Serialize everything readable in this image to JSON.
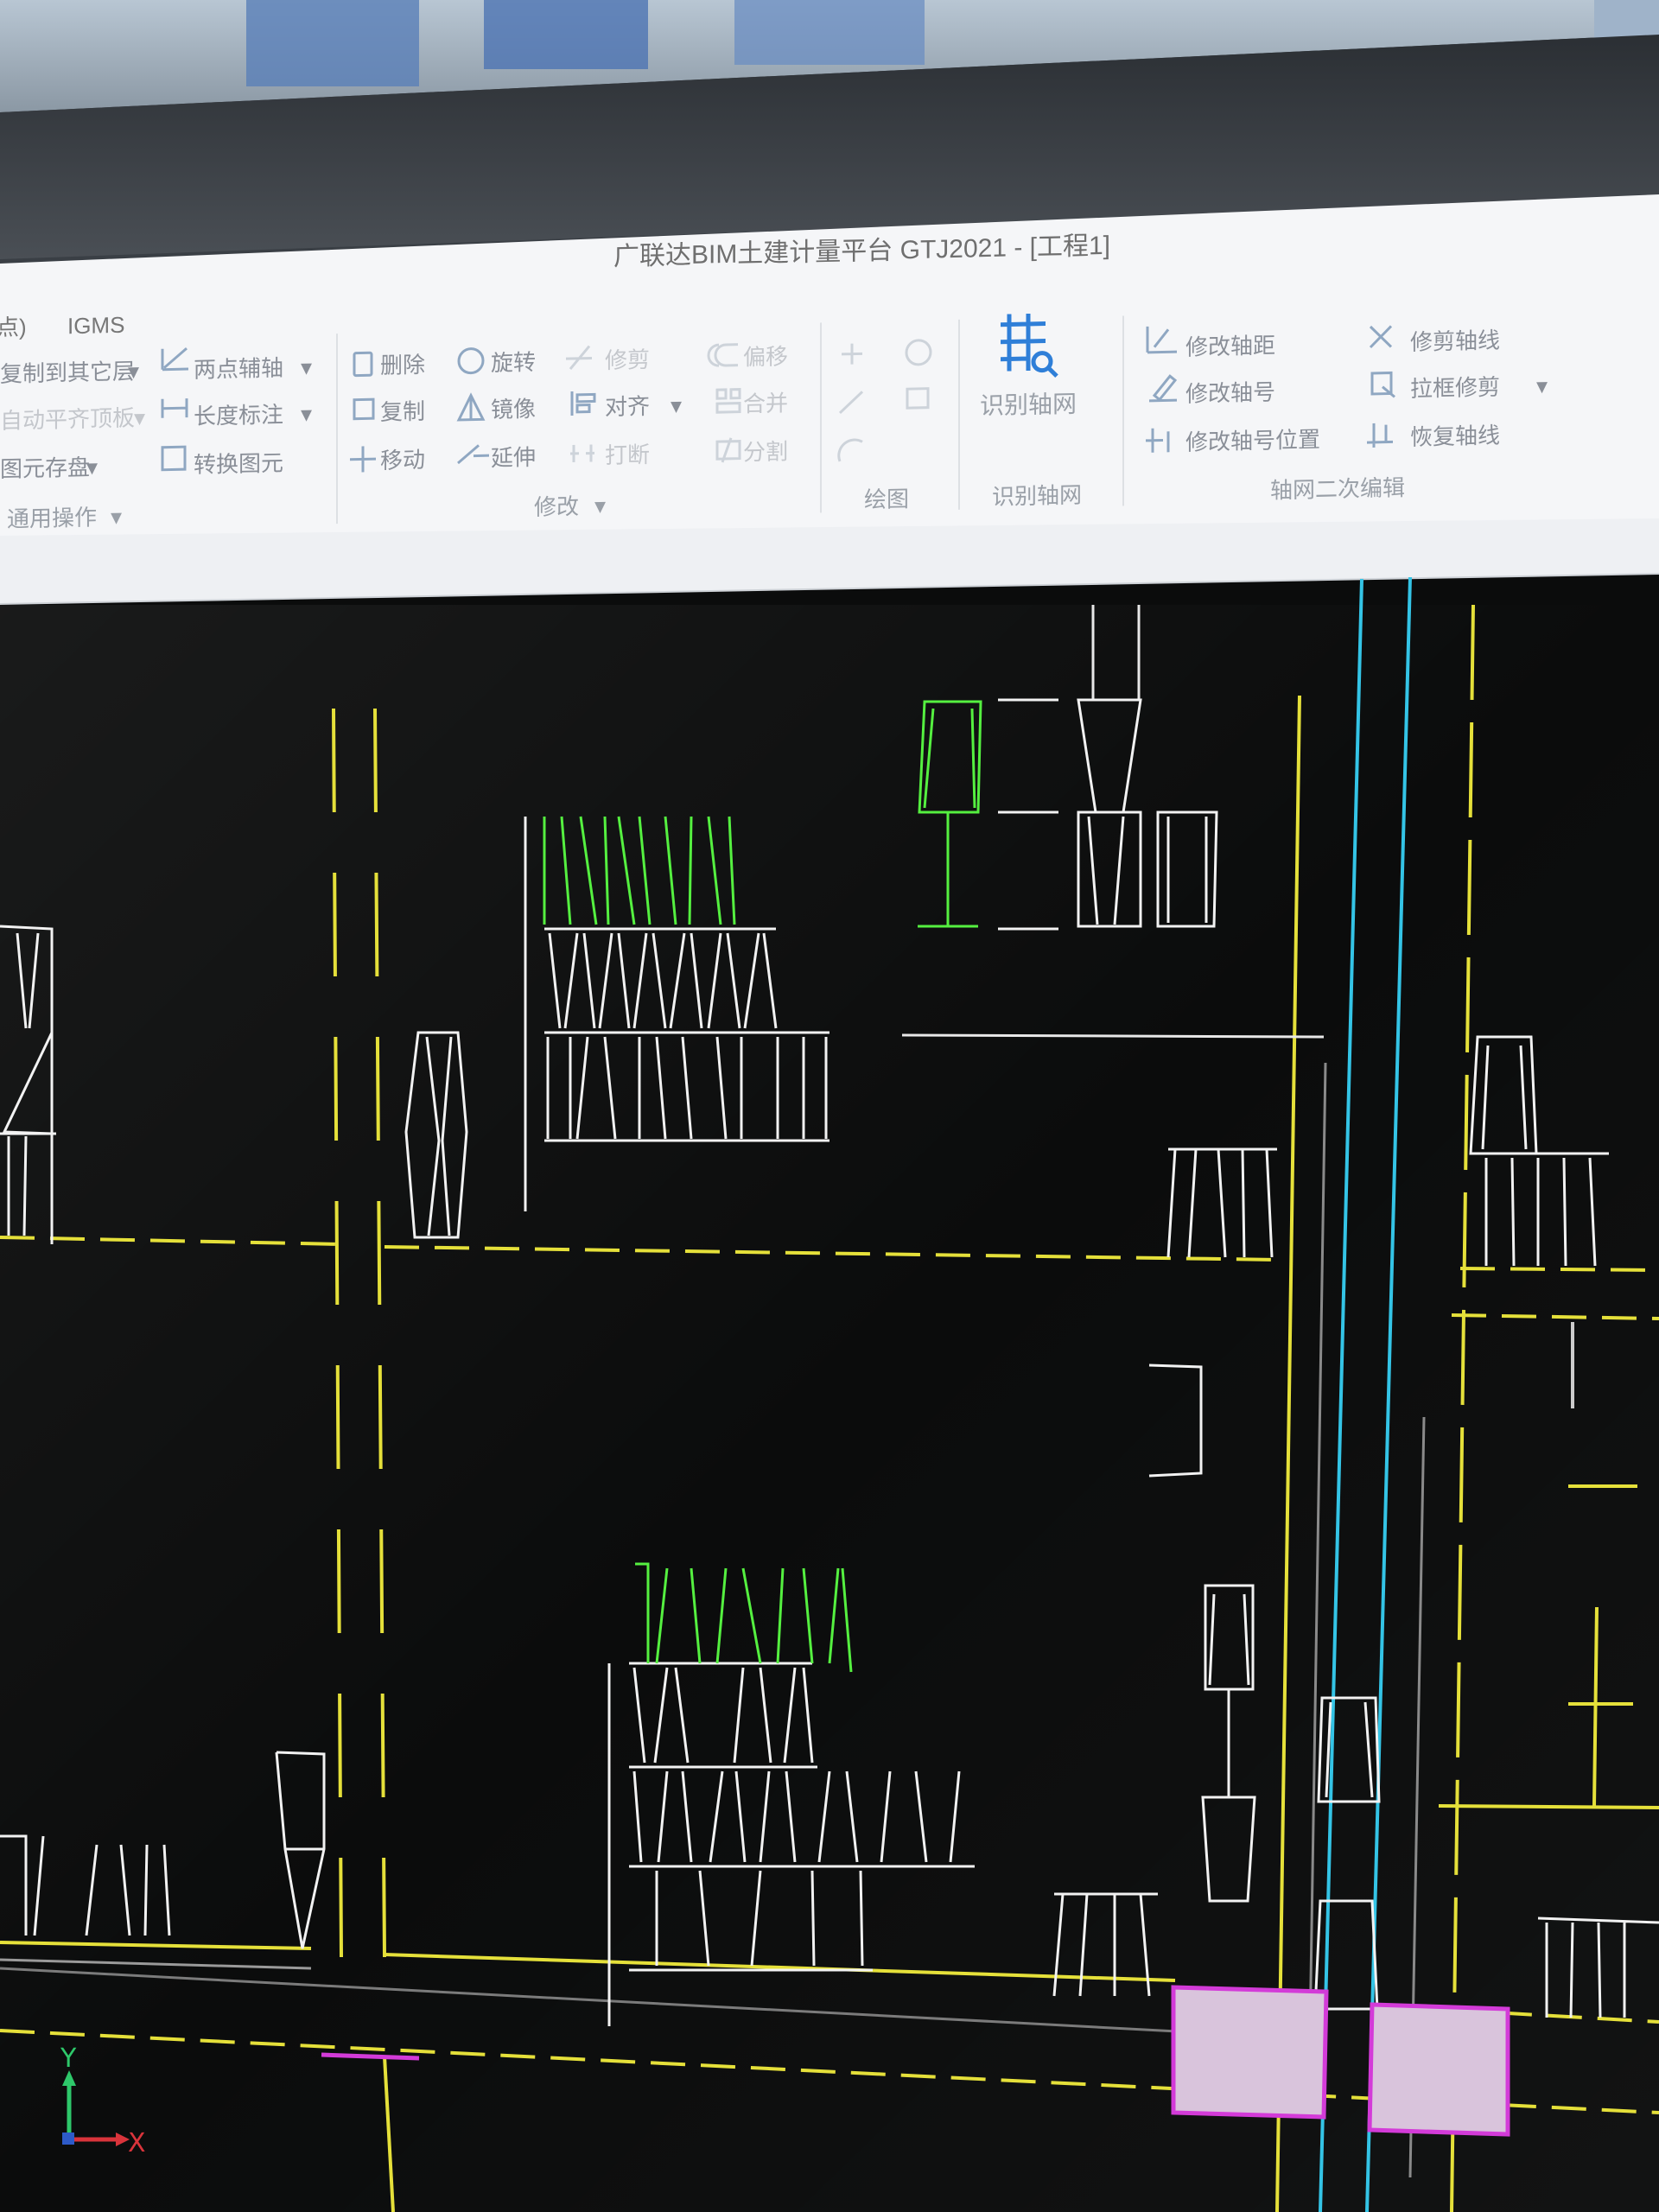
{
  "window": {
    "title": "广联达BIM土建计量平台 GTJ2021 - [工程1]"
  },
  "ribbon": {
    "tabs": [
      {
        "label": "点)"
      },
      {
        "label": "IGMS"
      }
    ],
    "general_group": {
      "items": [
        {
          "label": "复制到其它层",
          "dropdown": true
        },
        {
          "label": "自动平齐顶板",
          "dropdown": true,
          "disabled": true
        },
        {
          "label": "图元存盘",
          "dropdown": true
        },
        {
          "label": "通用操作",
          "dropdown": true
        }
      ],
      "aux_items": [
        {
          "label": "两点辅轴",
          "icon": "two-point-axis-icon",
          "dropdown": true
        },
        {
          "label": "长度标注",
          "icon": "length-dimension-icon",
          "dropdown": true
        },
        {
          "label": "转换图元",
          "icon": "convert-element-icon"
        }
      ]
    },
    "modify_group": {
      "title": "修改",
      "items": [
        {
          "label": "删除",
          "icon": "delete-icon"
        },
        {
          "label": "复制",
          "icon": "copy-icon"
        },
        {
          "label": "移动",
          "icon": "move-icon"
        },
        {
          "label": "旋转",
          "icon": "rotate-icon"
        },
        {
          "label": "镜像",
          "icon": "mirror-icon"
        },
        {
          "label": "延伸",
          "icon": "extend-icon"
        },
        {
          "label": "修剪",
          "icon": "trim-icon",
          "disabled": true
        },
        {
          "label": "对齐",
          "icon": "align-icon",
          "dropdown": true
        },
        {
          "label": "打断",
          "icon": "break-icon",
          "disabled": true
        },
        {
          "label": "偏移",
          "icon": "offset-icon",
          "disabled": true
        },
        {
          "label": "合并",
          "icon": "merge-icon",
          "disabled": true
        },
        {
          "label": "分割",
          "icon": "split-icon",
          "disabled": true
        }
      ]
    },
    "draw_group": {
      "title": "绘图"
    },
    "recognize_group": {
      "title": "识别轴网",
      "button_label": "识别轴网"
    },
    "axis_edit_group": {
      "title": "轴网二次编辑",
      "items": [
        {
          "label": "修改轴距",
          "icon": "edit-axis-distance-icon"
        },
        {
          "label": "修改轴号",
          "icon": "edit-axis-number-icon"
        },
        {
          "label": "修改轴号位置",
          "icon": "edit-axis-number-position-icon"
        },
        {
          "label": "修剪轴线",
          "icon": "trim-axis-icon"
        },
        {
          "label": "拉框修剪",
          "icon": "box-trim-icon",
          "dropdown": true
        },
        {
          "label": "恢复轴线",
          "icon": "restore-axis-icon"
        }
      ]
    }
  },
  "canvas": {
    "background": "#0b0c0c",
    "colors": {
      "axis_yellow": "#e5e03a",
      "axis_cyan": "#34c4e6",
      "entity_white": "#f2f2f2",
      "selected_green": "#55f040",
      "grip_magenta": "#d33bd8",
      "grip_fill": "#d9c4dc"
    },
    "ucs": {
      "x_label": "X",
      "y_label": "Y"
    }
  }
}
